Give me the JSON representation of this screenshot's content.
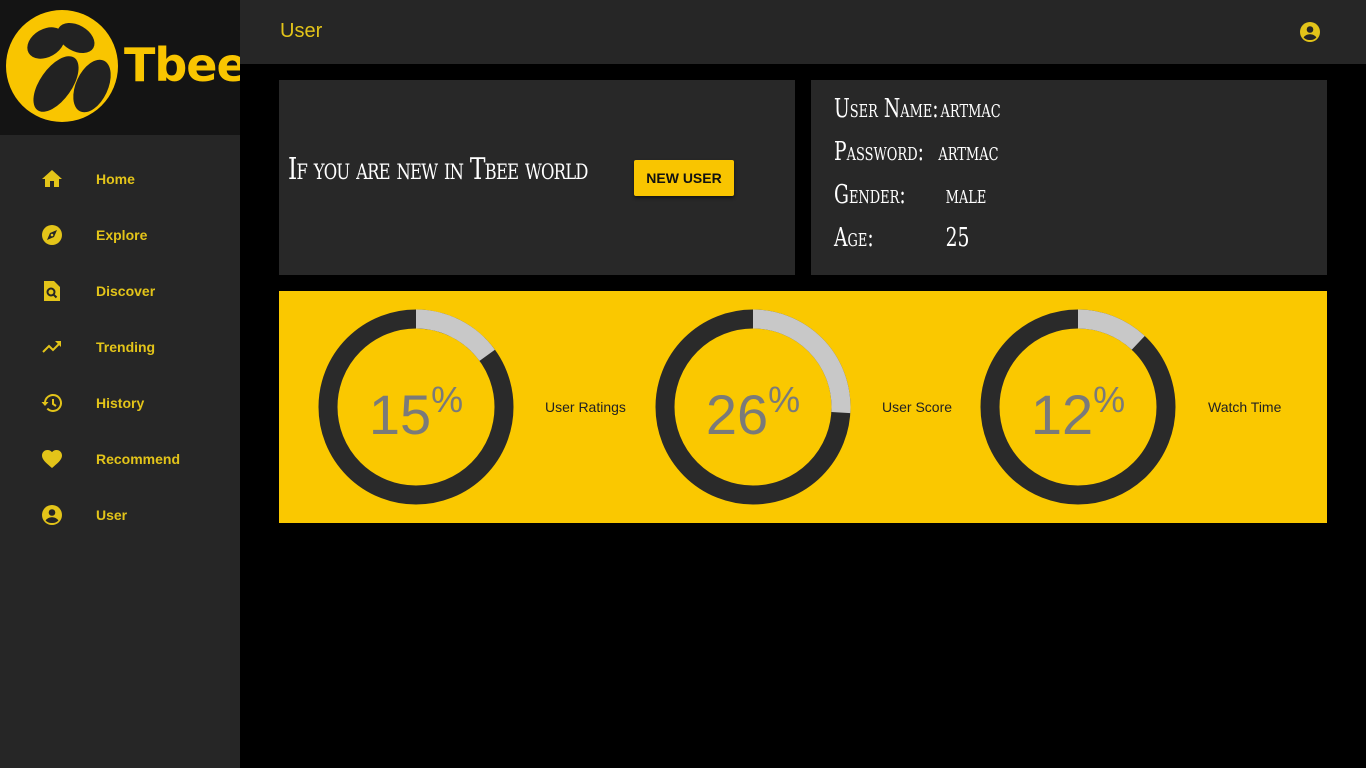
{
  "brand": {
    "name": "Tbee",
    "color": "#f9c500"
  },
  "nav": {
    "items": [
      {
        "label": "Home",
        "icon": "home-icon"
      },
      {
        "label": "Explore",
        "icon": "compass-icon"
      },
      {
        "label": "Discover",
        "icon": "find-in-page-icon"
      },
      {
        "label": "Trending",
        "icon": "trending-up-icon"
      },
      {
        "label": "History",
        "icon": "history-icon"
      },
      {
        "label": "Recommend",
        "icon": "heart-icon"
      },
      {
        "label": "User",
        "icon": "account-circle-icon"
      }
    ]
  },
  "header": {
    "title": "User",
    "account_icon": "account-circle-icon"
  },
  "promo": {
    "text": "If you are new in Tbee world",
    "button_label": "NEW USER"
  },
  "user_info": {
    "rows": [
      {
        "label": "User Name:",
        "value": "artmac"
      },
      {
        "label": "Password:",
        "value": "artmac"
      },
      {
        "label": "Gender:",
        "value": "male"
      },
      {
        "label": "Age:",
        "value": "25"
      }
    ]
  },
  "stats": [
    {
      "label": "User Ratings",
      "value": 15,
      "display": "15",
      "symbol": "%"
    },
    {
      "label": "User Score",
      "value": 26,
      "display": "26",
      "symbol": "%"
    },
    {
      "label": "Watch Time",
      "value": 12,
      "display": "12",
      "symbol": "%"
    }
  ],
  "colors": {
    "accent": "#f9c500",
    "sidebar": "#262626",
    "panel": "#282828",
    "ring": "#2a2a2a",
    "ring_fill": "#c8c8c8"
  }
}
